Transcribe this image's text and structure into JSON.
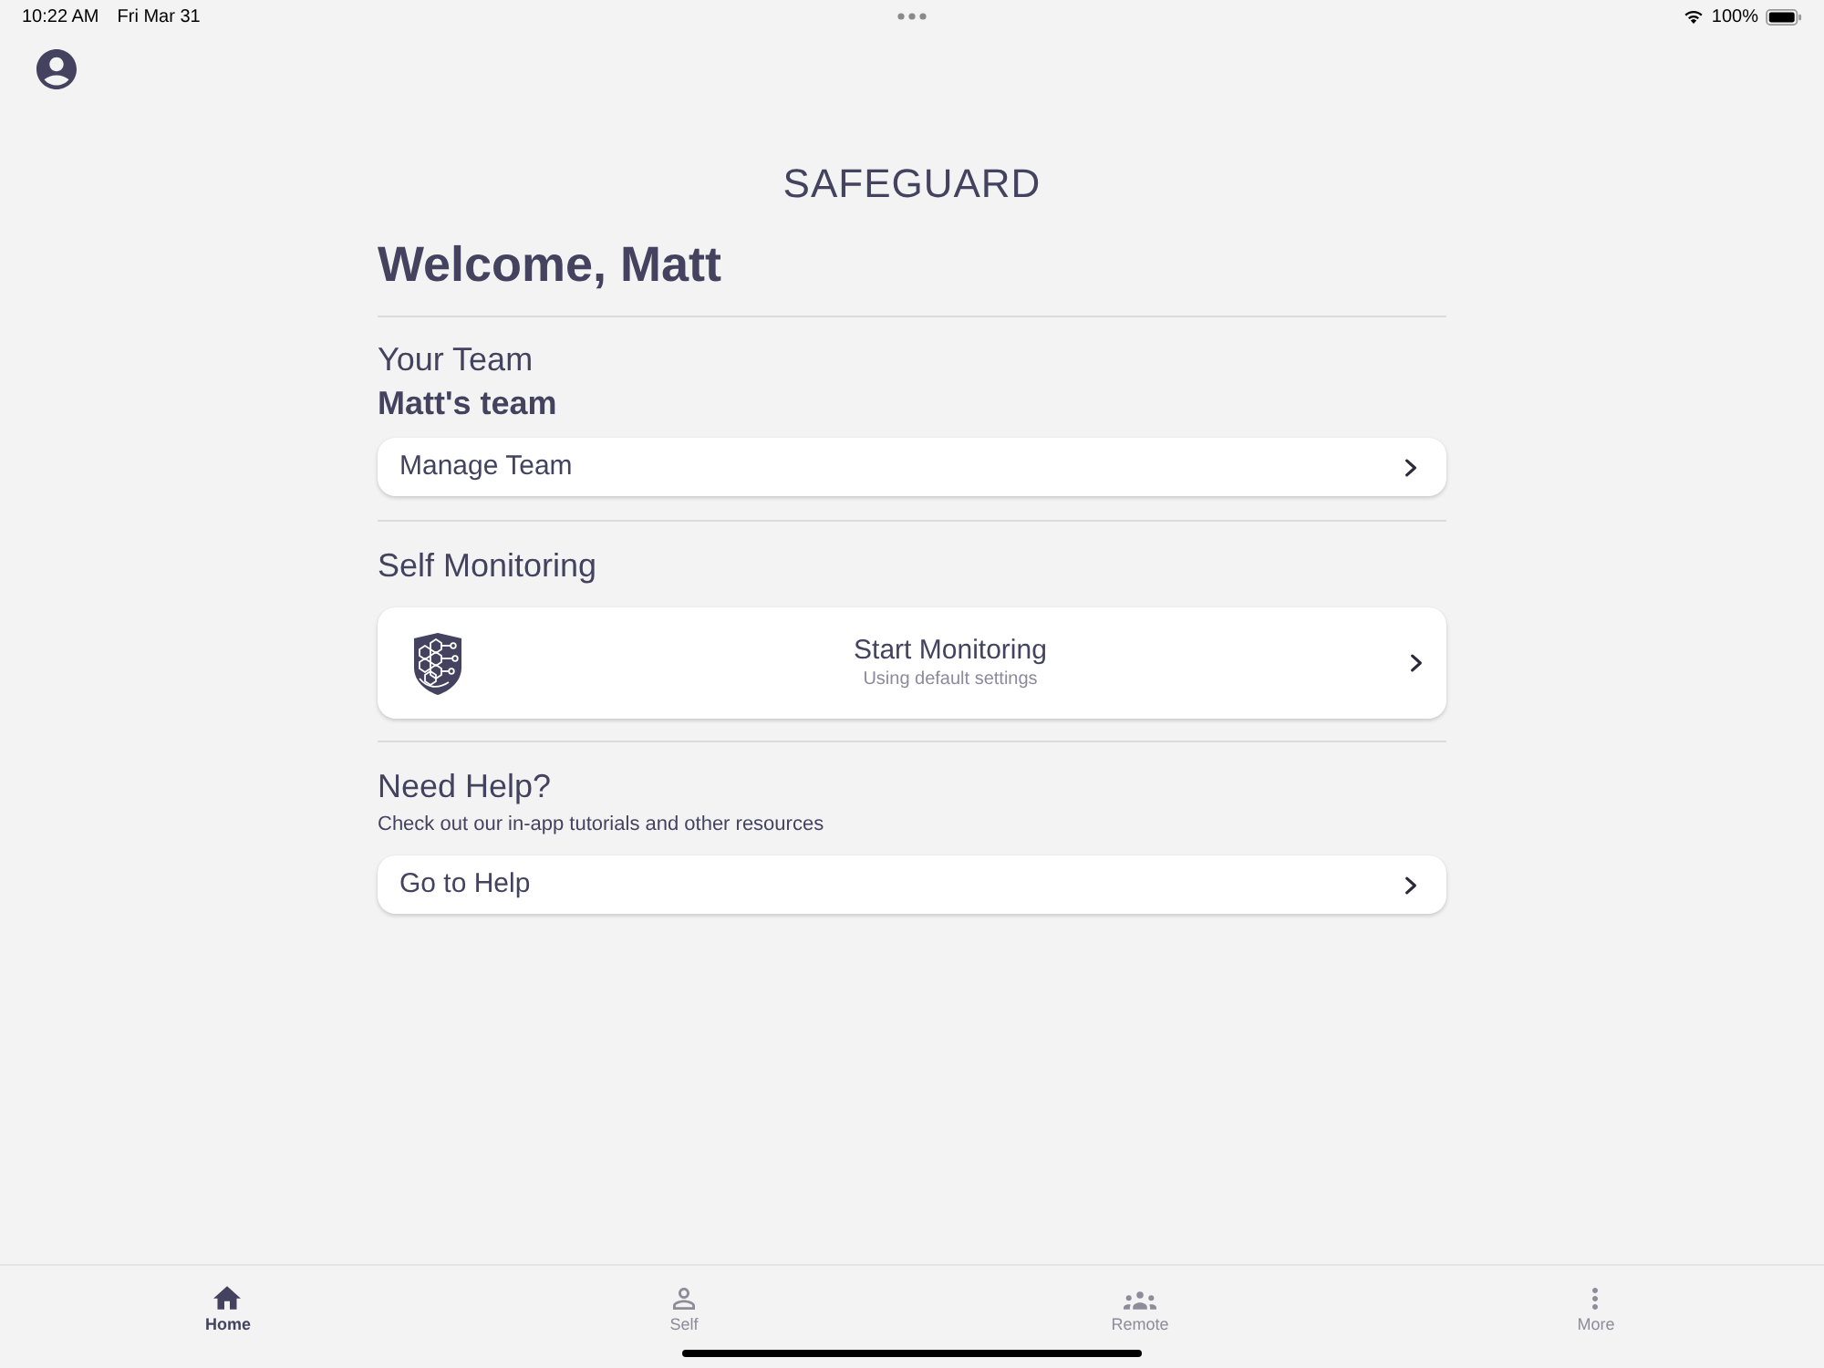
{
  "status_bar": {
    "time": "10:22 AM",
    "date": "Fri Mar 31",
    "battery": "100%"
  },
  "header": {
    "title": "SAFEGUARD"
  },
  "welcome": "Welcome, Matt",
  "team": {
    "heading": "Your Team",
    "name": "Matt's team",
    "action": "Manage Team"
  },
  "self_monitoring": {
    "heading": "Self Monitoring",
    "action": "Start Monitoring",
    "subtitle": "Using default settings"
  },
  "help": {
    "heading": "Need Help?",
    "description": "Check out our in-app tutorials and other resources",
    "action": "Go to Help"
  },
  "tab_bar": [
    {
      "kind": "home",
      "label": "Home",
      "selected": true
    },
    {
      "kind": "self",
      "label": "Self",
      "selected": false
    },
    {
      "kind": "remote",
      "label": "Remote",
      "selected": false
    },
    {
      "kind": "more",
      "label": "More",
      "selected": false
    }
  ]
}
